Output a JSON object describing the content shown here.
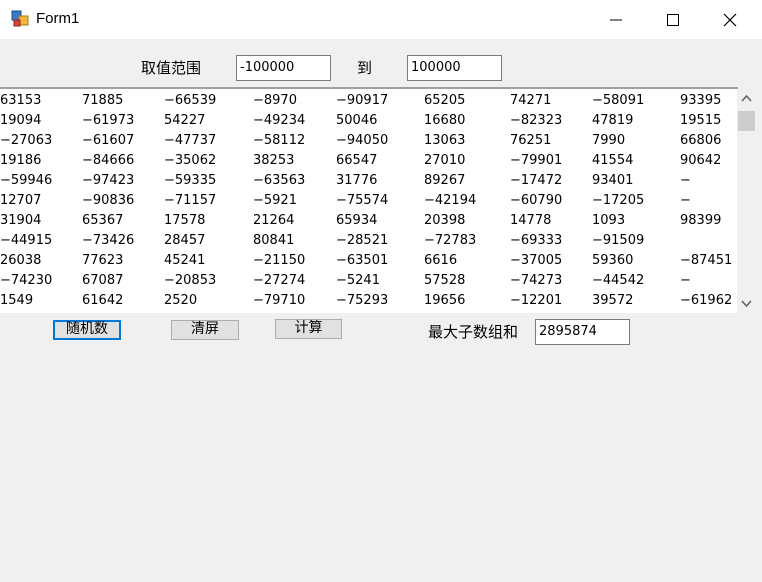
{
  "window": {
    "title": "Form1"
  },
  "range": {
    "label": "取值范围",
    "min_value": "-100000",
    "to_label": "到",
    "max_value": "100000"
  },
  "numbers": {
    "rows": [
      [
        "63153",
        "71885",
        "−66539",
        "−8970",
        "−90917",
        "65205",
        "74271",
        "−58091",
        "93395"
      ],
      [
        "19094",
        "−61973",
        "54227",
        "−49234",
        "50046",
        "16680",
        "−82323",
        "47819",
        "19515"
      ],
      [
        "−27063",
        "−61607",
        "−47737",
        "−58112",
        "−94050",
        "13063",
        "76251",
        "7990",
        "66806"
      ],
      [
        "19186",
        "−84666",
        "−35062",
        "38253",
        "66547",
        "27010",
        "−79901",
        "41554",
        "90642"
      ],
      [
        "−59946",
        "−97423",
        "−59335",
        "−63563",
        "31776",
        "89267",
        "−17472",
        "93401",
        "−"
      ],
      [
        "12707",
        "−90836",
        "−71157",
        "−5921",
        "−75574",
        "−42194",
        "−60790",
        "−17205",
        "−"
      ],
      [
        "31904",
        "65367",
        "17578",
        "21264",
        "65934",
        "20398",
        "14778",
        "1093",
        "98399"
      ],
      [
        "−44915",
        "−73426",
        "28457",
        "80841",
        "−28521",
        "−72783",
        "−69333",
        "−91509",
        ""
      ],
      [
        "26038",
        "77623",
        "45241",
        "−21150",
        "−63501",
        "6616",
        "−37005",
        "59360",
        "−87451"
      ],
      [
        "−74230",
        "67087",
        "−20853",
        "−27274",
        "−5241",
        "57528",
        "−74273",
        "−44542",
        "−"
      ],
      [
        "1549",
        "61642",
        "2520",
        "−79710",
        "−75293",
        "19656",
        "−12201",
        "39572",
        "−61962"
      ]
    ]
  },
  "buttons": {
    "random": "随机数",
    "clear": "清屏",
    "calc": "计算"
  },
  "result": {
    "label": "最大子数组和",
    "value": "2895874"
  },
  "colors": {
    "focus_border": "#0078d7",
    "background": "#f0f0f0"
  }
}
